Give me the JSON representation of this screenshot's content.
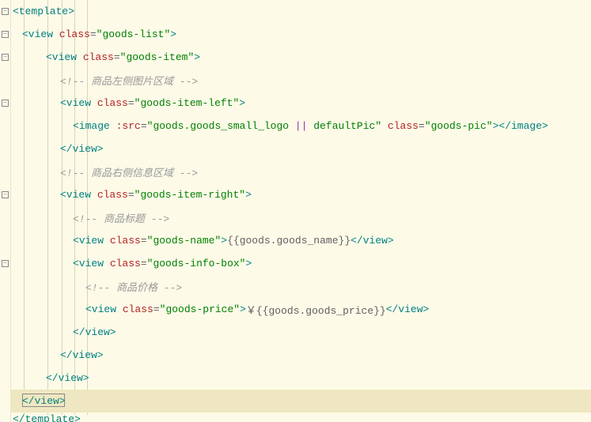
{
  "lines": [
    {
      "indent": 0,
      "fold": true,
      "segments": [
        {
          "t": "tag",
          "v": "<template>"
        }
      ]
    },
    {
      "indent": 1,
      "fold": true,
      "segments": [
        {
          "t": "tag",
          "v": "<view"
        },
        {
          "t": "text",
          "v": " "
        },
        {
          "t": "attr",
          "v": "class"
        },
        {
          "t": "text",
          "v": "="
        },
        {
          "t": "str",
          "v": "\"goods-list\""
        },
        {
          "t": "tag",
          "v": ">"
        }
      ]
    },
    {
      "indent": 2,
      "fold": true,
      "segments": [
        {
          "t": "tag",
          "v": "<view"
        },
        {
          "t": "text",
          "v": " "
        },
        {
          "t": "attr",
          "v": "class"
        },
        {
          "t": "text",
          "v": "="
        },
        {
          "t": "str",
          "v": "\"goods-item\""
        },
        {
          "t": "tag",
          "v": ">"
        }
      ]
    },
    {
      "indent": 3,
      "fold": false,
      "segments": [
        {
          "t": "comment",
          "v": "<!-- 商品左侧图片区域 -->"
        }
      ]
    },
    {
      "indent": 3,
      "fold": true,
      "segments": [
        {
          "t": "tag",
          "v": "<view"
        },
        {
          "t": "text",
          "v": " "
        },
        {
          "t": "attr",
          "v": "class"
        },
        {
          "t": "text",
          "v": "="
        },
        {
          "t": "str",
          "v": "\"goods-item-left\""
        },
        {
          "t": "tag",
          "v": ">"
        }
      ]
    },
    {
      "indent": 4,
      "fold": false,
      "segments": [
        {
          "t": "tag",
          "v": "<image"
        },
        {
          "t": "text",
          "v": " "
        },
        {
          "t": "attr",
          "v": ":src"
        },
        {
          "t": "text",
          "v": "="
        },
        {
          "t": "str",
          "v": "\"goods.goods_small_logo "
        },
        {
          "t": "op",
          "v": "||"
        },
        {
          "t": "str",
          "v": " defaultPic\""
        },
        {
          "t": "text",
          "v": " "
        },
        {
          "t": "attr",
          "v": "class"
        },
        {
          "t": "text",
          "v": "="
        },
        {
          "t": "str",
          "v": "\"goods-pic\""
        },
        {
          "t": "tag",
          "v": "></image>"
        }
      ]
    },
    {
      "indent": 3,
      "fold": false,
      "segments": [
        {
          "t": "tag",
          "v": "</view>"
        }
      ]
    },
    {
      "indent": 3,
      "fold": false,
      "segments": [
        {
          "t": "comment",
          "v": "<!-- 商品右侧信息区域 -->"
        }
      ]
    },
    {
      "indent": 3,
      "fold": true,
      "segments": [
        {
          "t": "tag",
          "v": "<view"
        },
        {
          "t": "text",
          "v": " "
        },
        {
          "t": "attr",
          "v": "class"
        },
        {
          "t": "text",
          "v": "="
        },
        {
          "t": "str",
          "v": "\"goods-item-right\""
        },
        {
          "t": "tag",
          "v": ">"
        }
      ]
    },
    {
      "indent": 4,
      "fold": false,
      "segments": [
        {
          "t": "comment",
          "v": "<!-- 商品标题 -->"
        }
      ]
    },
    {
      "indent": 4,
      "fold": false,
      "segments": [
        {
          "t": "tag",
          "v": "<view"
        },
        {
          "t": "text",
          "v": " "
        },
        {
          "t": "attr",
          "v": "class"
        },
        {
          "t": "text",
          "v": "="
        },
        {
          "t": "str",
          "v": "\"goods-name\""
        },
        {
          "t": "tag",
          "v": ">"
        },
        {
          "t": "interp",
          "v": "{{goods.goods_name}}"
        },
        {
          "t": "tag",
          "v": "</view>"
        }
      ]
    },
    {
      "indent": 4,
      "fold": true,
      "segments": [
        {
          "t": "tag",
          "v": "<view"
        },
        {
          "t": "text",
          "v": " "
        },
        {
          "t": "attr",
          "v": "class"
        },
        {
          "t": "text",
          "v": "="
        },
        {
          "t": "str",
          "v": "\"goods-info-box\""
        },
        {
          "t": "tag",
          "v": ">"
        }
      ]
    },
    {
      "indent": 5,
      "fold": false,
      "segments": [
        {
          "t": "comment",
          "v": "<!-- 商品价格 -->"
        }
      ]
    },
    {
      "indent": 5,
      "fold": false,
      "segments": [
        {
          "t": "tag",
          "v": "<view"
        },
        {
          "t": "text",
          "v": " "
        },
        {
          "t": "attr",
          "v": "class"
        },
        {
          "t": "text",
          "v": "="
        },
        {
          "t": "str",
          "v": "\"goods-price\""
        },
        {
          "t": "tag",
          "v": ">"
        },
        {
          "t": "interp",
          "v": "￥{{goods.goods_price}}"
        },
        {
          "t": "tag",
          "v": "</view>"
        }
      ]
    },
    {
      "indent": 4,
      "fold": false,
      "segments": [
        {
          "t": "tag",
          "v": "</view>"
        }
      ]
    },
    {
      "indent": 3,
      "fold": false,
      "segments": [
        {
          "t": "tag",
          "v": "</view>"
        }
      ]
    },
    {
      "indent": 2,
      "fold": false,
      "segments": [
        {
          "t": "tag",
          "v": "</view>"
        }
      ]
    },
    {
      "indent": 1,
      "fold": false,
      "highlight": true,
      "segments": [
        {
          "t": "tag",
          "v": "</view>"
        }
      ]
    },
    {
      "indent": 0,
      "fold": false,
      "cut": true,
      "segments": [
        {
          "t": "tag",
          "v": "</template>"
        }
      ]
    }
  ]
}
